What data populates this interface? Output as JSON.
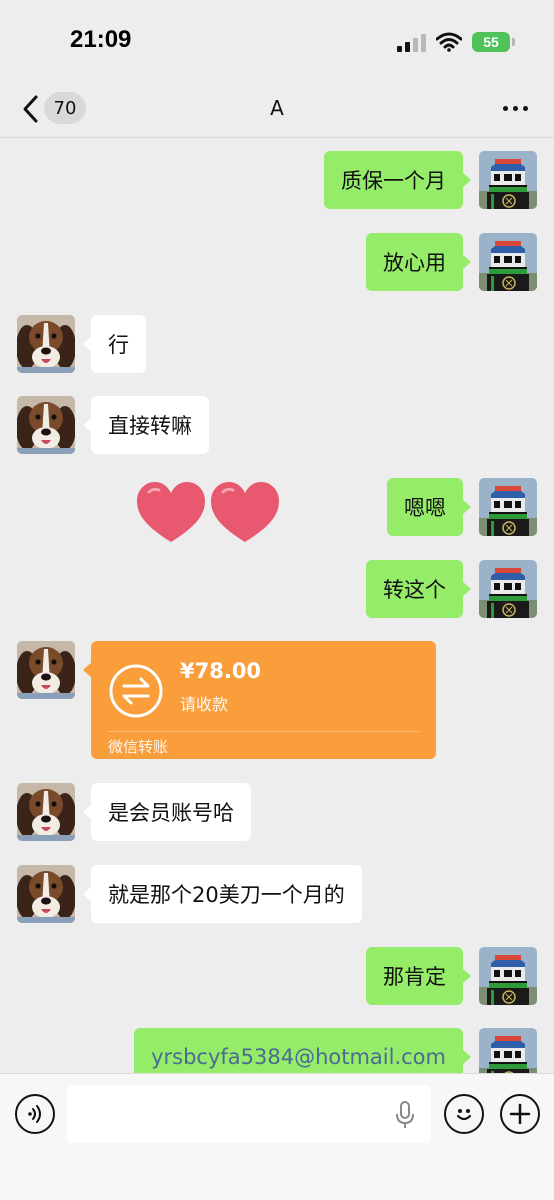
{
  "status_bar": {
    "time": "21:09",
    "battery": "55"
  },
  "nav": {
    "unread_count": "70",
    "title": "A"
  },
  "messages": [
    {
      "side": "me",
      "text": "质保一个月"
    },
    {
      "side": "me",
      "text": "放心用"
    },
    {
      "side": "other",
      "text": "行"
    },
    {
      "side": "other",
      "text": "直接转嘛"
    },
    {
      "side": "me",
      "text": "嗯嗯"
    },
    {
      "side": "me",
      "text": "转这个"
    },
    {
      "side": "other",
      "type": "transfer",
      "amount": "¥78.00",
      "status": "请收款",
      "footer": "微信转账"
    },
    {
      "side": "other",
      "text": "是会员账号哈"
    },
    {
      "side": "other",
      "text": "就是那个20美刀一个月的"
    },
    {
      "side": "me",
      "text": "那肯定"
    },
    {
      "side": "me",
      "text": "yrsbcyfa5384@hotmail.com"
    }
  ],
  "sticker": {
    "name": "two-hearts-sticker",
    "color": "#e8586e"
  },
  "input_bar": {
    "placeholder": ""
  },
  "colors": {
    "my_bubble": "#95ec69",
    "other_bubble": "#ffffff",
    "transfer": "#fa9d3b",
    "background": "#ededed"
  }
}
